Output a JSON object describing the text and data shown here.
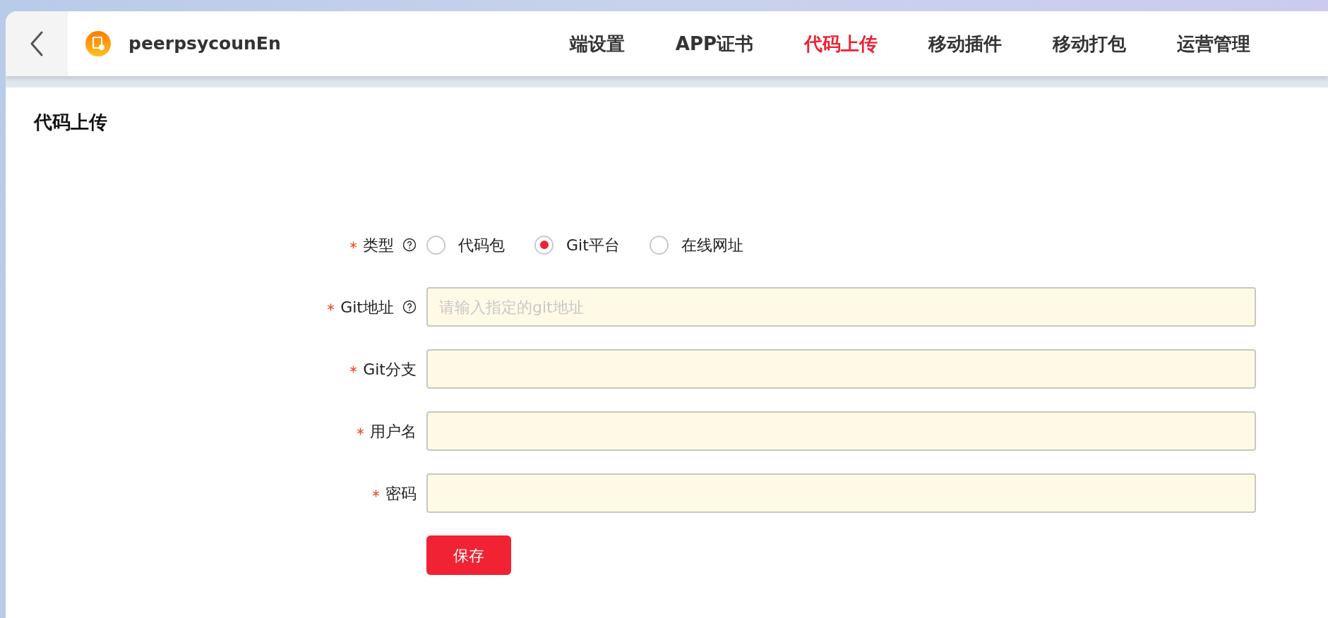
{
  "header": {
    "app_name": "peerpsycounEn",
    "nav": [
      {
        "label": "端设置",
        "selected": false
      },
      {
        "label": "APP证书",
        "selected": false
      },
      {
        "label": "代码上传",
        "selected": true
      },
      {
        "label": "移动插件",
        "selected": false
      },
      {
        "label": "移动打包",
        "selected": false
      },
      {
        "label": "运营管理",
        "selected": false
      }
    ]
  },
  "page_title": "代码上传",
  "form": {
    "fields": [
      {
        "kind": "radio",
        "label": "类型",
        "required": true,
        "help": true,
        "options": [
          {
            "label": "代码包",
            "selected": false
          },
          {
            "label": "Git平台",
            "selected": true
          },
          {
            "label": "在线网址",
            "selected": false
          }
        ]
      },
      {
        "kind": "input",
        "label": "Git地址",
        "required": true,
        "help": true,
        "placeholder": "请输入指定的git地址"
      },
      {
        "kind": "input",
        "label": "Git分支",
        "required": true,
        "help": false
      },
      {
        "kind": "input",
        "label": "用户名",
        "required": true,
        "help": false
      },
      {
        "kind": "input",
        "label": "密码",
        "required": true,
        "help": false
      }
    ],
    "submit": "保存"
  }
}
